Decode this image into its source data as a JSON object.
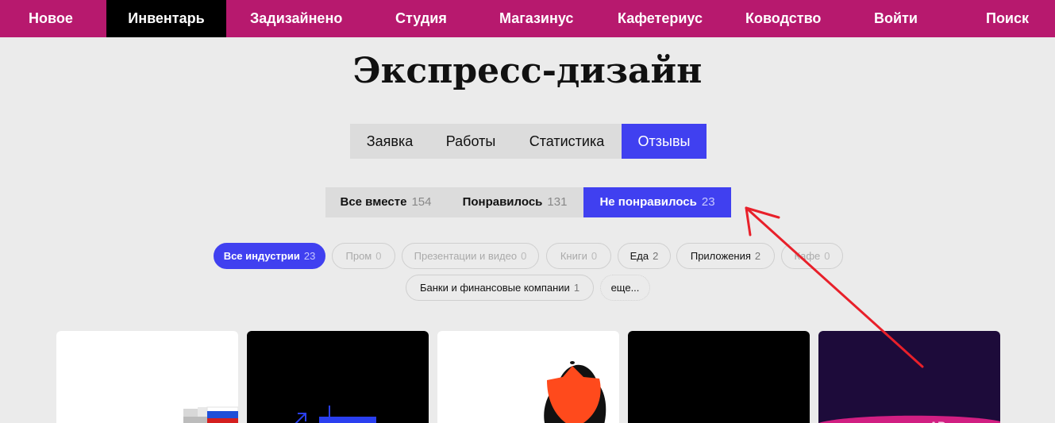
{
  "topnav": {
    "items": [
      {
        "label": "Новое"
      },
      {
        "label": "Инвентарь"
      },
      {
        "label": "Задизайнено"
      },
      {
        "label": "Студия"
      },
      {
        "label": "Магазинус"
      },
      {
        "label": "Кафетериус"
      },
      {
        "label": "Ководство"
      },
      {
        "label": "Войти"
      },
      {
        "label": "Поиск"
      }
    ],
    "active_index": 1
  },
  "page": {
    "title": "Экспресс-дизайн"
  },
  "tabs": {
    "items": [
      {
        "label": "Заявка"
      },
      {
        "label": "Работы"
      },
      {
        "label": "Статистика"
      },
      {
        "label": "Отзывы"
      }
    ],
    "active_index": 3
  },
  "filters": {
    "items": [
      {
        "label": "Все вместе",
        "count": "154"
      },
      {
        "label": "Понравилось",
        "count": "131"
      },
      {
        "label": "Не понравилось",
        "count": "23"
      }
    ],
    "active_index": 2
  },
  "industries": {
    "items": [
      {
        "label": "Все индустрии",
        "count": "23",
        "state": "active"
      },
      {
        "label": "Пром",
        "count": "0",
        "state": "disabled"
      },
      {
        "label": "Презентации и видео",
        "count": "0",
        "state": "disabled"
      },
      {
        "label": "Книги",
        "count": "0",
        "state": "disabled"
      },
      {
        "label": "Еда",
        "count": "2",
        "state": "normal"
      },
      {
        "label": "Приложения",
        "count": "2",
        "state": "normal"
      },
      {
        "label": "Кафе",
        "count": "0",
        "state": "disabled"
      },
      {
        "label": "Банки и финансовые компании",
        "count": "1",
        "state": "normal"
      }
    ],
    "more_label": "еще..."
  },
  "colors": {
    "brand": "#b7196e",
    "accent": "#4040f0",
    "annotation_arrow": "#e8202a",
    "page_background": "#ebebeb"
  }
}
